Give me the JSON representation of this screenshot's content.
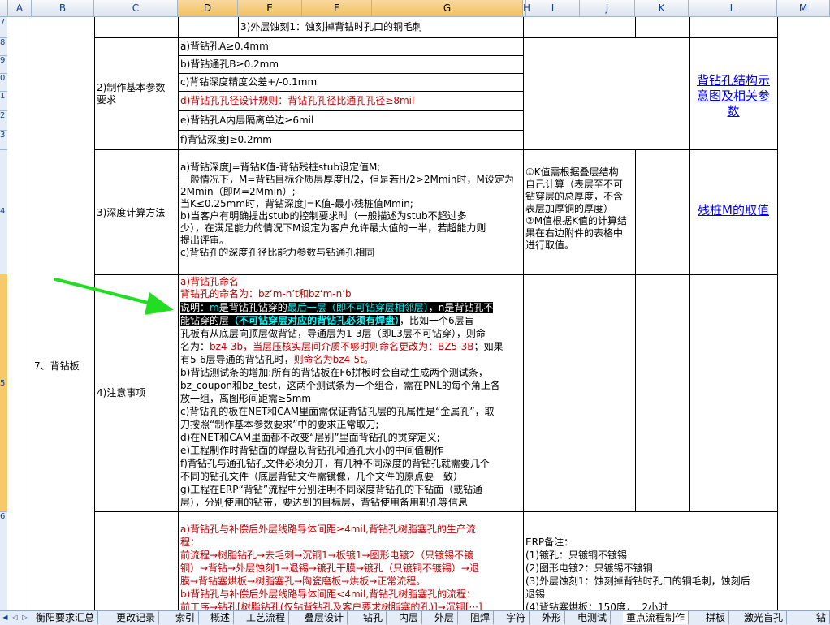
{
  "columns": [
    "A",
    "B",
    "C",
    "D",
    "E",
    "F",
    "G",
    "H",
    "I",
    "J",
    "K",
    "L",
    "M"
  ],
  "rows": [
    "7",
    "8",
    "9",
    "0",
    "1",
    "2",
    "3",
    "4",
    "5",
    "6",
    "7",
    "8"
  ],
  "cells": {
    "top_row_text": "3)外层蚀刻1：蚀刻掉背钻时孔口的铜毛刺",
    "step2_label": [
      "2)制作基本参数",
      "要求"
    ],
    "params": [
      "a)背钻孔A≥0.4mm",
      "b)背钻通孔B≥0.2mm",
      "c)背钻深度精度公差+/-0.1mm",
      "d)背钻孔孔径设计规则：背钻孔孔径比通孔孔径≥8mil",
      "e)背钻孔A内层隔离单边≥6mil",
      "f)背钻深度J≥0.2mm"
    ],
    "params_link": [
      "背钻孔结构示",
      "意图及相关参",
      "数"
    ],
    "step3_label": "3)深度计算方法",
    "depth_lines": [
      "a)背钻深度J=背钻K值-背钻残桩stub设定值M;",
      "一般情况下，M=背钻目标介质层厚度H/2，但是若H/2>2Mmin时，M设定为",
      "2Mmin（即M=2Mmin）;",
      "当K≤0.25mm时，背钻深度J=K值-最小残桩值Mmin;",
      "b)当客户有明确提出stub的控制要求时（一般描述为stub不超过多",
      "少），在满足能力的情况下M设定为客户允许最大值的一半，若超能力则",
      "提出评审。",
      "c)背钻孔的深度孔径比能力参数与钻通孔相同"
    ],
    "depth_note": [
      "①K值需根据叠层结构",
      "自己计算（表层至不可",
      "钻穿层的总厚度，不含",
      "表层加厚铜的厚度）",
      "②M值根据K值的计算结",
      "果在右边附件的表格中",
      "进行取值。"
    ],
    "depth_link": "残桩M的取值",
    "section_label": "7、背钻板",
    "step4_label": "4)注意事项",
    "notes_a_title": "a)背钻孔命名",
    "notes_a_naming": "背钻孔的命名为：bz‘m-n’t和bz‘m-n’b",
    "notes_line3": {
      "p1": "说明：",
      "p2": "m",
      "p3": "是背钻孔钻穿的",
      "p4": "最后一层（即不可钻穿层相邻层）",
      "p5": "，n是背钻孔不"
    },
    "notes_line4": {
      "p1": "能钻穿的层",
      "p2": "（不可钻穿层对应的背钻孔必须有焊盘）",
      "p3": "，比如一个6层盲"
    },
    "notes_line5": "孔板有从底层向顶层做背钻，导通层为1-3层（即L3层不可钻穿），则命",
    "notes_line6": {
      "p1": "名为：",
      "p2": "bz4-3b，当层压核实层间介质不够时则命名更改为：BZ5-3B",
      "p3": "；如果"
    },
    "notes_line7": {
      "p1": "有5-6层导通的背钻孔时，",
      "p2": "则命名为bz4-5t。"
    },
    "notes_rest": [
      "b)背钻测试条的增加:所有的背钻板在F6拼板时会自动生成两个测试条，",
      "bz_coupon和bz_test，这两个测试条为一个组合，需在PNL的每个角上各",
      "放一组，离图形间距需≥5mm",
      "c)背钻孔的板在NET和CAM里面需保证背钻孔层的孔属性是“金属孔”，取",
      "刀按照“制作基本参数要求”中的要求正常取刀;",
      "d)在NET和CAM里面都不改变“层别”里面背钻孔的贯穿定义;",
      "e)工程制作时背钻面的焊盘以背钻孔和通孔大小的中间值制作",
      "f)背钻孔与通孔钻孔文件必须分开，有几种不同深度的背钻孔就需要几个",
      "不同的钻孔文件（底层背钻文件需镜像，几个文件的原点要一致）",
      "g)工程在ERP“背钻”流程中分别注明不同深度背钻孔的下钻面（或钻通",
      "层），分别使用的钻带，要达到的目标层，背钻使用备用靶孔等信息"
    ],
    "flow_lines": [
      "a)背钻孔与补偿后外层线路导体间距≥4mil,背钻孔树脂塞孔的生产流",
      "程：",
      "前流程→树脂钻孔→去毛刺→沉铜1→板镀1→图形电镀2（只镀锡不镀",
      "铜）→背钻→外层蚀刻1→退锡→镀孔干膜→镀孔（只镀铜不镀锡）→退",
      "膜→背钻塞烘板→树脂塞孔→陶瓷磨板→烘板→正常流程。",
      "b)背钻孔与补偿后外层线路导体间距<4mil,背钻孔树脂塞孔的流程：",
      "前工序→钻孔[树脂钻孔(仅钻背钻孔及客户要求树脂塞的孔)]→沉铜[···]"
    ],
    "erp_lines": [
      "ERP备注：",
      "(1)镀孔：只镀铜不镀锡",
      "(2)图形电镀2：只镀锡不镀铜",
      "(3)外层蚀刻1：蚀刻掉背钻时孔口的铜毛刺，蚀刻后",
      "退锡",
      "(4)背钻塞烘板：150度，  2小时"
    ]
  },
  "arrow_color": "#22dd22",
  "sheet_tabs": [
    "衡阳要求汇总",
    "更改记录",
    "索引",
    "概述",
    "工艺流程",
    "叠层设计",
    "钻孔",
    "内层",
    "外层",
    "阻焊",
    "字符",
    "外形",
    "电测试",
    "重点流程制作",
    "拼板",
    "激光盲孔",
    "钻"
  ],
  "active_tab": "重点流程制作"
}
